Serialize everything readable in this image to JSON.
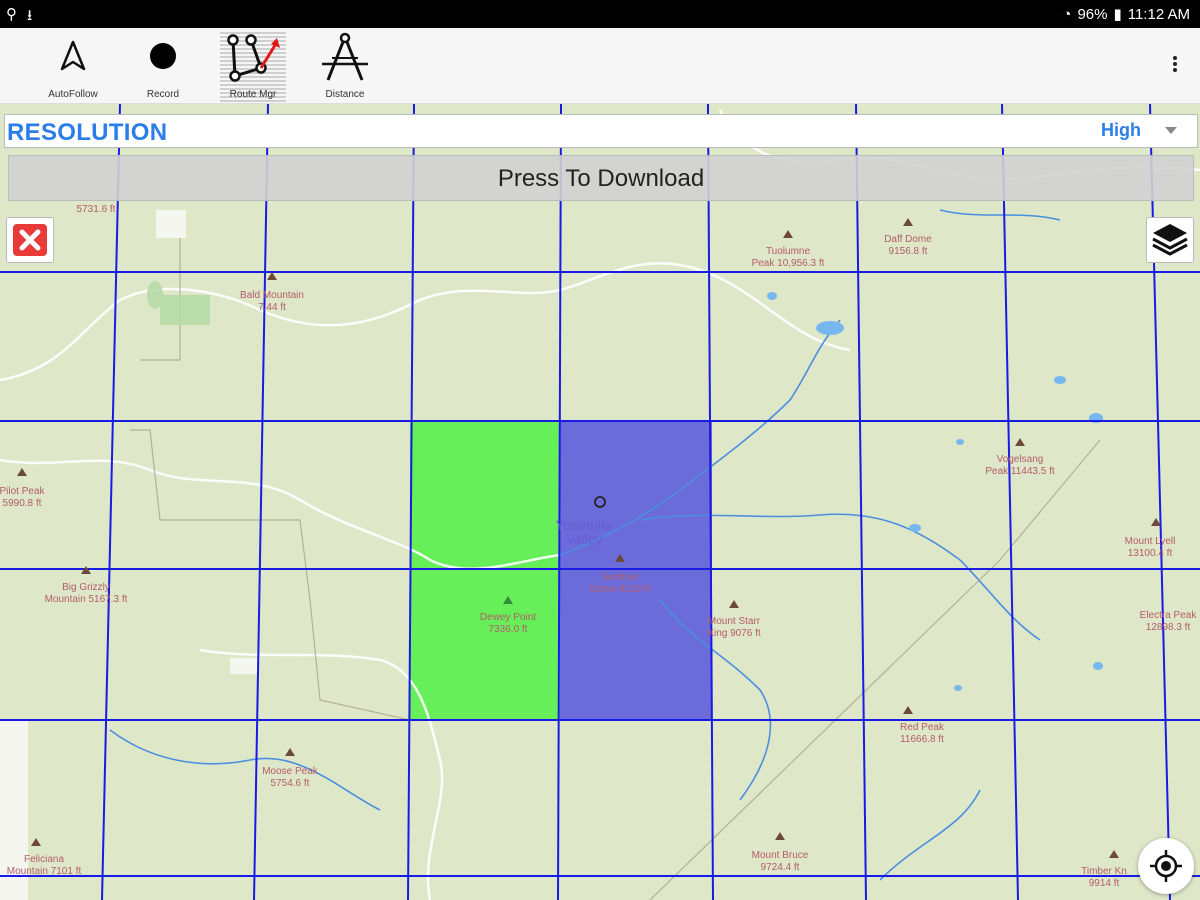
{
  "status_bar": {
    "left_icons": [
      "signal-icon",
      "download-icon"
    ],
    "left_text": "ᵢP",
    "battery": "96%",
    "time": "11:12 AM"
  },
  "toolbar": {
    "tools": [
      {
        "label": "AutoFollow",
        "icon": "navigation-arrow-icon"
      },
      {
        "label": "Record",
        "icon": "record-dot-icon"
      },
      {
        "label": "Route Mgr",
        "icon": "route-manager-icon"
      },
      {
        "label": "Distance",
        "icon": "compass-divider-icon"
      }
    ],
    "more_icon": "overflow-menu-icon"
  },
  "resolution": {
    "title": "RESOLUTION",
    "selected": "High"
  },
  "download": {
    "label": "Press To Download"
  },
  "colors": {
    "grid": "#1a1ae6",
    "tile_selected_green": "#5cf04f",
    "tile_selected_blue": "#5e5edc",
    "accent": "#2b7de9",
    "close_red": "#e93a3a"
  },
  "map": {
    "peaks": [
      {
        "name": "Bald Mountain",
        "elev": "7.44 ft"
      },
      {
        "name": "Tuolumne",
        "elev": "Peak 10,956.3 ft"
      },
      {
        "name": "Daff Dome",
        "elev": "9156.8 ft"
      },
      {
        "name": "Pilot Peak",
        "elev": "5990.8 ft"
      },
      {
        "name": "Vogelsang",
        "elev": "Peak 11443.5 ft"
      },
      {
        "name": "Mount Lyell",
        "elev": "13100.4 ft"
      },
      {
        "name": "Big Grizzly",
        "elev": "Mountain 5167.3 ft"
      },
      {
        "name": "Sentinel",
        "elev": "Dome 8120 ft"
      },
      {
        "name": "Dewey Point",
        "elev": "7336.0 ft"
      },
      {
        "name": "Mount Starr",
        "elev": "King 9076 ft"
      },
      {
        "name": "Electra Peak",
        "elev": "12898.3 ft"
      },
      {
        "name": "Red Peak",
        "elev": "11666.8 ft"
      },
      {
        "name": "Moose Peak",
        "elev": "5754.6 ft"
      },
      {
        "name": "Mount Bruce",
        "elev": "9724.4 ft"
      },
      {
        "name": "Feliciana",
        "elev": "Mountain 7101 ft"
      },
      {
        "name": "Timber Kn",
        "elev": "9914 ft"
      },
      {
        "name": "",
        "elev": "5731.6 ft"
      }
    ],
    "place": "Yosemite Valley"
  }
}
